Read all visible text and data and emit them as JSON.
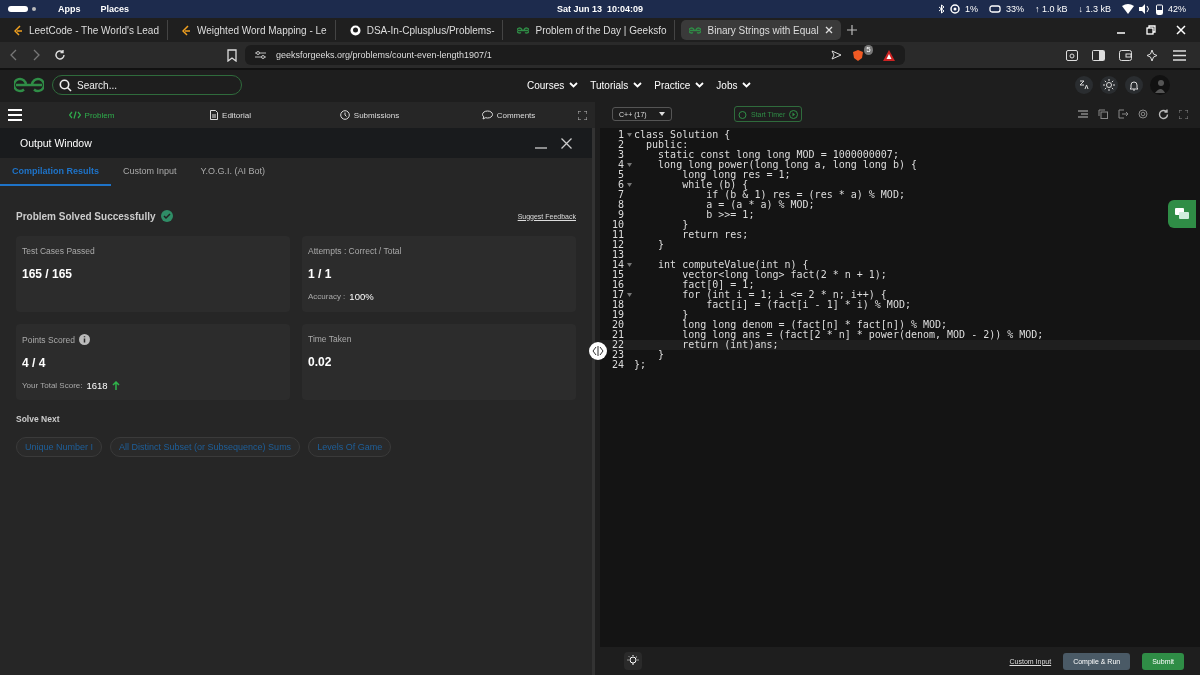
{
  "system_bar": {
    "menus": [
      "Apps",
      "Places"
    ],
    "clock": "Sat Jun 13  10:04:09",
    "indicators": [
      "1%",
      "33%",
      "↑ 1.0 kB",
      "↓ 1.3 kB",
      "42%"
    ]
  },
  "browser": {
    "tabs": [
      {
        "title": "LeetCode - The World's Lead",
        "kind": "leetcode",
        "selected": false
      },
      {
        "title": "Weighted Word Mapping - Le",
        "kind": "leetcode",
        "selected": false
      },
      {
        "title": "DSA-In-Cplusplus/Problems-",
        "kind": "github",
        "selected": false
      },
      {
        "title": "Problem of the Day | Geeksfo",
        "kind": "gfg",
        "selected": false
      },
      {
        "title": "Binary Strings with Equal",
        "kind": "gfg",
        "selected": true
      }
    ],
    "url": "geeksforgeeks.org/problems/count-even-length1907/1",
    "shield_count": "5"
  },
  "site_header": {
    "search": {
      "placeholder": "Search..."
    },
    "nav": [
      "Courses",
      "Tutorials",
      "Practice",
      "Jobs"
    ]
  },
  "problem_tabs": [
    {
      "label": "Problem",
      "kind": "code",
      "selected": true
    },
    {
      "label": "Editorial",
      "kind": "doc",
      "selected": false
    },
    {
      "label": "Submissions",
      "kind": "clock",
      "selected": false
    },
    {
      "label": "Comments",
      "kind": "chat",
      "selected": false
    }
  ],
  "output_window": {
    "title": "Output Window",
    "tabs": [
      {
        "label": "Compilation Results",
        "selected": true
      },
      {
        "label": "Custom Input",
        "selected": false
      },
      {
        "label": "Y.O.G.I. (AI Bot)",
        "selected": false
      }
    ],
    "status": "Problem Solved Successfully",
    "feedback": "Suggest Feedback",
    "cards": [
      {
        "label": "Test Cases Passed",
        "value": "165 / 165"
      },
      {
        "label": "Attempts : Correct / Total",
        "value": "1 / 1",
        "note_label": "Accuracy :",
        "note_value": "100%"
      },
      {
        "label": "Points Scored",
        "value": "4 / 4",
        "note_label": "Your Total Score:",
        "note_value": "1618",
        "info": true,
        "trend_up": true
      },
      {
        "label": "Time Taken",
        "value": "0.02"
      }
    ],
    "solve_next": {
      "heading": "Solve Next",
      "problems": [
        "Unique Number I",
        "All Distinct Subset (or Subsequence) Sums",
        "Levels Of Game"
      ]
    }
  },
  "editor": {
    "language": "C++ (17)",
    "timer": "Start Timer",
    "lines": [
      {
        "n": "1",
        "code": "class Solution {",
        "fold": true,
        "active": false
      },
      {
        "n": "2",
        "code": "  public:",
        "fold": false,
        "active": false
      },
      {
        "n": "3",
        "code": "    static const long long MOD = 1000000007;",
        "fold": false,
        "active": false
      },
      {
        "n": "4",
        "code": "    long long power(long long a, long long b) {",
        "fold": true,
        "active": false
      },
      {
        "n": "5",
        "code": "        long long res = 1;",
        "fold": false,
        "active": false
      },
      {
        "n": "6",
        "code": "        while (b) {",
        "fold": true,
        "active": false
      },
      {
        "n": "7",
        "code": "            if (b & 1) res = (res * a) % MOD;",
        "fold": false,
        "active": false
      },
      {
        "n": "8",
        "code": "            a = (a * a) % MOD;",
        "fold": false,
        "active": false
      },
      {
        "n": "9",
        "code": "            b >>= 1;",
        "fold": false,
        "active": false
      },
      {
        "n": "10",
        "code": "        }",
        "fold": false,
        "active": false
      },
      {
        "n": "11",
        "code": "        return res;",
        "fold": false,
        "active": false
      },
      {
        "n": "12",
        "code": "    }",
        "fold": false,
        "active": false
      },
      {
        "n": "13",
        "fold": false,
        "active": false
      },
      {
        "n": "14",
        "code": "    int computeValue(int n) {",
        "fold": true,
        "active": false
      },
      {
        "n": "15",
        "code": "        vector<long long> fact(2 * n + 1);",
        "fold": false,
        "active": false
      },
      {
        "n": "16",
        "code": "        fact[0] = 1;",
        "fold": false,
        "active": false
      },
      {
        "n": "17",
        "code": "        for (int i = 1; i <= 2 * n; i++) {",
        "fold": true,
        "active": false
      },
      {
        "n": "18",
        "code": "            fact[i] = (fact[i - 1] * i) % MOD;",
        "fold": false,
        "active": false
      },
      {
        "n": "19",
        "code": "        }",
        "fold": false,
        "active": false
      },
      {
        "n": "20",
        "code": "        long long denom = (fact[n] * fact[n]) % MOD;",
        "fold": false,
        "active": false
      },
      {
        "n": "21",
        "code": "        long long ans = (fact[2 * n] * power(denom, MOD - 2)) % MOD;",
        "fold": false,
        "active": false
      },
      {
        "n": "22",
        "code": "        return (int)ans;",
        "fold": false,
        "active": true
      },
      {
        "n": "23",
        "code": "    }",
        "fold": false,
        "active": false
      },
      {
        "n": "24",
        "code": "};",
        "fold": false,
        "active": false
      }
    ],
    "footer": {
      "link": "Custom Input",
      "run": "Compile & Run",
      "submit": "Submit"
    }
  }
}
